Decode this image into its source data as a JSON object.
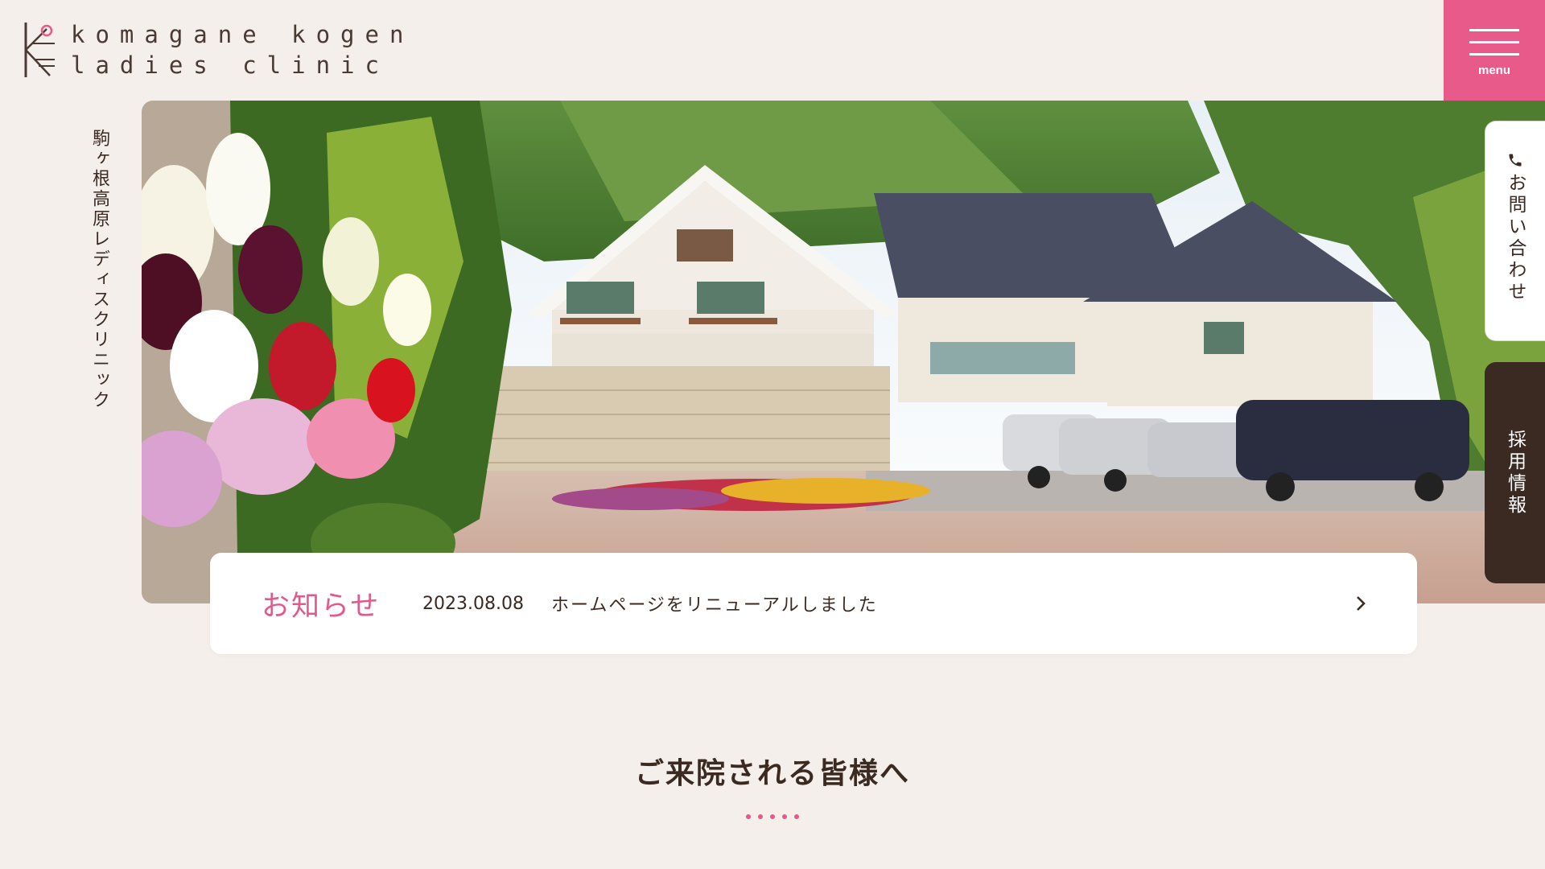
{
  "logo": {
    "line1": "komagane kogen",
    "line2": "ladies clinic"
  },
  "clinic_name_vertical": "駒ヶ根高原レディスクリニック",
  "hero": {
    "image": "clinic-building-photo"
  },
  "menu": {
    "label": "menu"
  },
  "side_tabs": {
    "contact": "お問い合わせ",
    "recruit": "採用情報"
  },
  "news": {
    "title": "お知らせ",
    "date": "2023.08.08",
    "text": "ホームページをリニューアルしました"
  },
  "section": {
    "title": "ご来院される皆様へ"
  },
  "colors": {
    "accent": "#e85a8a",
    "background": "#f4efeb",
    "dark": "#3a2a22"
  },
  "icons": [
    "logo-mark",
    "hamburger-icon",
    "phone-icon",
    "chevron-right-icon"
  ]
}
